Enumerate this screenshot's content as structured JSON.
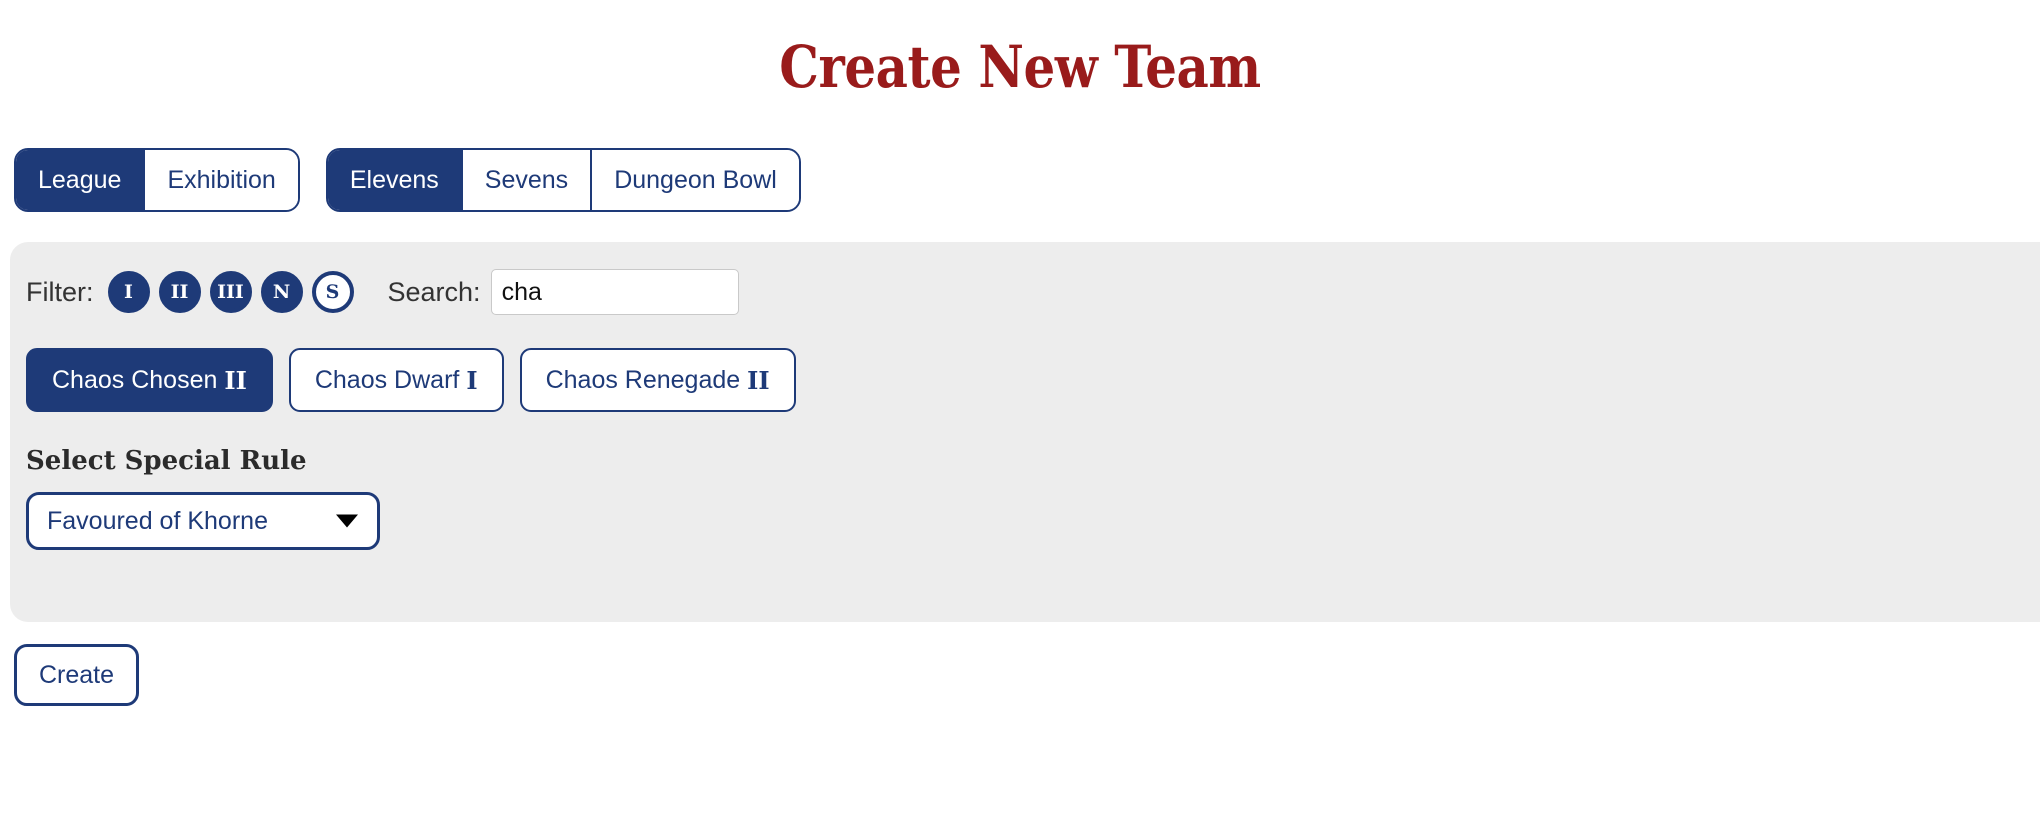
{
  "page": {
    "title": "Create New Team"
  },
  "mode_toggle": {
    "name": "match-type",
    "options": [
      {
        "label": "League",
        "active": true
      },
      {
        "label": "Exhibition",
        "active": false
      }
    ]
  },
  "format_toggle": {
    "name": "team-format",
    "options": [
      {
        "label": "Elevens",
        "active": true
      },
      {
        "label": "Sevens",
        "active": false
      },
      {
        "label": "Dungeon Bowl",
        "active": false
      }
    ]
  },
  "filter": {
    "label": "Filter:",
    "badges": [
      {
        "label": "I",
        "title": "Tier I",
        "selected": true
      },
      {
        "label": "II",
        "title": "Tier II",
        "selected": true
      },
      {
        "label": "III",
        "title": "Tier III",
        "selected": true
      },
      {
        "label": "N",
        "title": "New",
        "selected": true
      },
      {
        "label": "S",
        "title": "Special",
        "selected": false
      }
    ]
  },
  "search": {
    "label": "Search:",
    "value": "cha",
    "placeholder": ""
  },
  "teams": [
    {
      "name": "Chaos Chosen",
      "tier": "II",
      "selected": true
    },
    {
      "name": "Chaos Dwarf",
      "tier": "I",
      "selected": false
    },
    {
      "name": "Chaos Renegade",
      "tier": "II",
      "selected": false
    }
  ],
  "special_rule": {
    "heading": "Select Special Rule",
    "selected": "Favoured of Khorne",
    "options": [
      "Favoured of Khorne"
    ]
  },
  "actions": {
    "create_label": "Create"
  },
  "colors": {
    "title_red": "#991b1b",
    "navy": "#1e3a78",
    "panel_grey": "#ededed"
  }
}
